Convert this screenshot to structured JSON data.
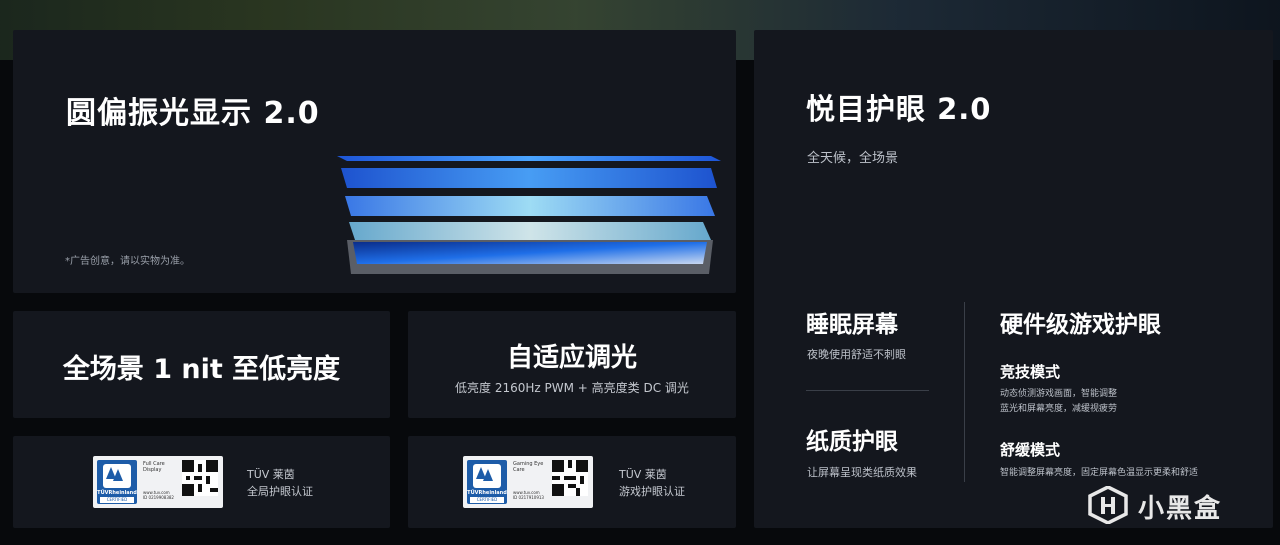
{
  "display_panel": {
    "title": "圆偏振光显示 2.0",
    "note": "*广告创意，请以实物为准。"
  },
  "eye_panel": {
    "title": "悦目护眼 2.0",
    "subtitle": "全天候，全场景",
    "sleep": {
      "title": "睡眠屏幕",
      "desc": "夜晚使用舒适不刺眼"
    },
    "paper": {
      "title": "纸质护眼",
      "desc": "让屏幕呈现类纸质效果"
    },
    "game": {
      "title": "硬件级游戏护眼",
      "competitive": {
        "title": "竞技模式",
        "desc_line1": "动态侦测游戏画面，智能调整",
        "desc_line2": "蓝光和屏幕亮度，减缓视疲劳"
      },
      "ease": {
        "title": "舒缓模式",
        "desc": "智能调整屏幕亮度，固定屏幕色温显示更柔和舒适"
      }
    }
  },
  "nit_panel": {
    "title": "全场景 1 nit 至低亮度"
  },
  "dimming_panel": {
    "title": "自适应调光",
    "subtitle": "低亮度 2160Hz PWM + 高亮度类 DC 调光"
  },
  "cert1": {
    "badge_logo": "TÜVRheinland",
    "badge_certified": "CERTIFIED",
    "badge_title": "Full Care Display",
    "badge_url": "www.tuv.com",
    "badge_id": "ID 0219908382",
    "line1": "TÜV 莱茵",
    "line2": "全局护眼认证"
  },
  "cert2": {
    "badge_logo": "TÜVRheinland",
    "badge_certified": "CERTIFIED",
    "badge_title": "Gaming Eye Care",
    "badge_url": "www.tuv.com",
    "badge_id": "ID 0217910913",
    "line1": "TÜV 莱茵",
    "line2": "游戏护眼认证"
  },
  "watermark": {
    "text": "小黑盒",
    "icon": "heybox-logo-icon"
  },
  "colors": {
    "panel": "#14171e",
    "background": "#07090c",
    "layer_blue": "#2f7dff",
    "layer_cyan": "#8fe3ff"
  }
}
